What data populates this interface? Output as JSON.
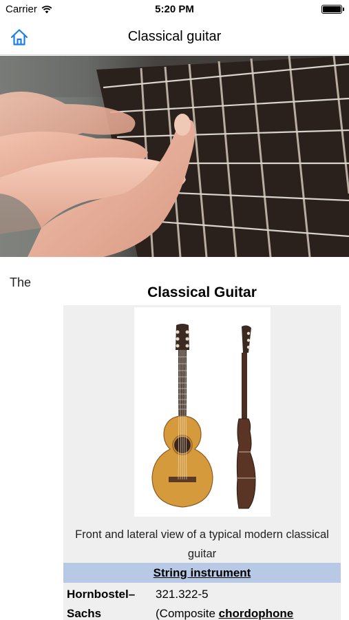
{
  "status_bar": {
    "carrier": "Carrier",
    "time": "5:20 PM",
    "battery_level": 1.0
  },
  "nav": {
    "title": "Classical guitar",
    "home_icon": "home-icon",
    "accent_color": "#1a7ee6"
  },
  "article": {
    "lead_word": "The",
    "infobox": {
      "title": "Classical Guitar",
      "image_caption": "Front and lateral view of a typical modern classical guitar",
      "section_header": "String instrument",
      "section_header_color": "#b7c9e4",
      "rows": [
        {
          "label": "Hornbostel–Sachs",
          "value_line1": "321.322-5",
          "value_prefix": "(Composite ",
          "value_link": "chordophone"
        }
      ]
    }
  }
}
